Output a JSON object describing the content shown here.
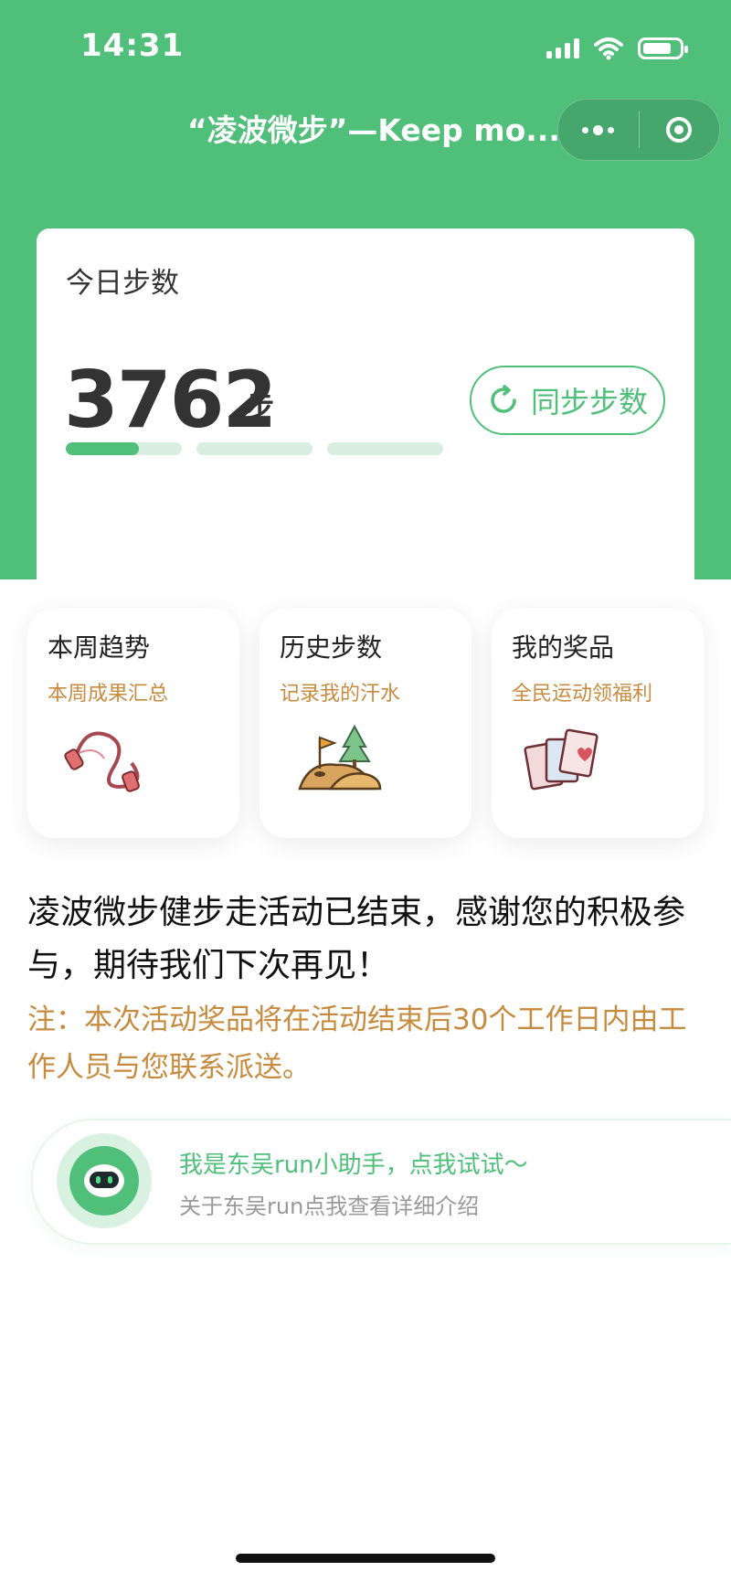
{
  "status_bar": {
    "time": "14:31",
    "icons": [
      "signal-icon",
      "wifi-icon",
      "battery-icon"
    ]
  },
  "navbar": {
    "title": "“凌波微步”—Keep mo...",
    "menu_icon": "more-dots-icon",
    "close_icon": "target-circle-icon"
  },
  "steps_card": {
    "title": "今日步数",
    "count": "3762",
    "unit": "步",
    "progress": [
      0.63,
      0,
      0
    ],
    "sync_button": {
      "icon": "refresh-icon",
      "label": "同步步数"
    }
  },
  "features": [
    {
      "title": "本周趋势",
      "subtitle": "本周成果汇总",
      "icon": "jump-rope-icon"
    },
    {
      "title": "历史步数",
      "subtitle": "记录我的汗水",
      "icon": "hill-flag-tree-icon"
    },
    {
      "title": "我的奖品",
      "subtitle": "全民运动领福利",
      "icon": "cards-heart-icon"
    }
  ],
  "notice": "凌波微步健步走活动已结束，感谢您的积极参与，期待我们下次再见！",
  "note": "注：本次活动奖品将在活动结束后30个工作日内由工作人员与您联系派送。",
  "assistant": {
    "icon": "robot-icon",
    "title": "我是东吴run小助手，点我试试～",
    "subtitle": "关于东吴run点我查看详细介绍"
  },
  "colors": {
    "brand_green": "#4fbf7a",
    "accent_orange": "#c78b3f"
  }
}
